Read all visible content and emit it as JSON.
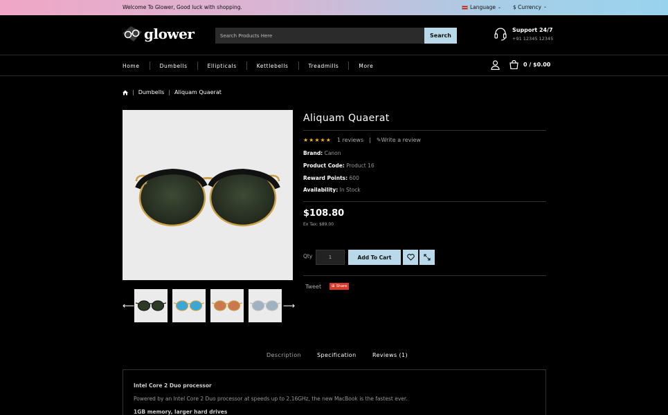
{
  "topbar": {
    "welcome": "Welcome To Glower, Good luck with shopping.",
    "language": "Language",
    "currency": "$ Currency"
  },
  "brand": {
    "logo_text": "glower"
  },
  "search": {
    "placeholder": "Search Products Here",
    "button": "Search"
  },
  "support": {
    "title": "Support 24/7",
    "phone": "+91 12345 12345"
  },
  "nav": {
    "items": [
      "Home",
      "Dumbells",
      "Ellipticals",
      "Kettlebells",
      "Treadmills",
      "More"
    ]
  },
  "cart": {
    "summary": "0 / $0.00"
  },
  "breadcrumb": {
    "items": [
      "Dumbells",
      "Aliquam Quaerat"
    ]
  },
  "product": {
    "title": "Aliquam Quaerat",
    "rating": 5,
    "reviews": "1 reviews",
    "write_review": "Write a review",
    "brand_label": "Brand:",
    "brand": "Canon",
    "code_label": "Product Code:",
    "code": "Product 16",
    "reward_label": "Reward Points:",
    "reward": "600",
    "avail_label": "Availability:",
    "avail": "In Stock",
    "price": "$108.80",
    "ex_tax": "Ex Tax: $89.00",
    "qty_label": "Qty",
    "qty": "1",
    "add_to_cart": "Add To Cart",
    "tweet": "Tweet",
    "share": "Share"
  },
  "thumbnails": [
    {
      "lens": "#2d3b25",
      "frame": "#1a1a1a"
    },
    {
      "lens": "#3aa7d8",
      "frame": "#c9a048"
    },
    {
      "lens": "#c9794b",
      "frame": "#c9a048"
    },
    {
      "lens": "#9fb2c2",
      "frame": "#bcbcbc"
    }
  ],
  "tabs": {
    "description": "Description",
    "specification": "Specification",
    "reviews": "Reviews (1)"
  },
  "description": {
    "heading": "Intel Core 2 Duo processor",
    "text": "Powered by an Intel Core 2 Duo processor at speeds up to 2.16GHz, the new MacBook is the fastest ever.",
    "heading2": "1GB memory, larger hard drives"
  },
  "colors": {
    "accent": "#b9d9ea",
    "star": "#f3b21a",
    "share": "#d93a2b"
  }
}
